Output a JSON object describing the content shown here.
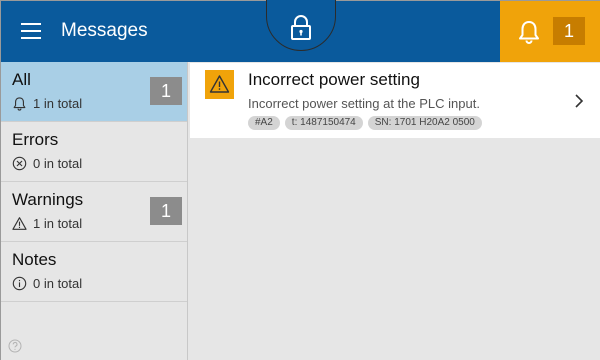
{
  "header": {
    "title": "Messages",
    "menu_icon": "hamburger-menu-icon",
    "lock_icon": "padlock-icon",
    "alarm": {
      "icon": "bell-icon",
      "count": "1",
      "color": "#f0a30a"
    },
    "color": "#0a5a9c"
  },
  "sidebar": {
    "items": [
      {
        "label": "All",
        "sub": "1 in total",
        "icon": "bell-icon",
        "badge": "1",
        "active": true
      },
      {
        "label": "Errors",
        "sub": "0 in total",
        "icon": "error-circle-x-icon",
        "badge": null,
        "active": false
      },
      {
        "label": "Warnings",
        "sub": "1 in total",
        "icon": "warning-triangle-icon",
        "badge": "1",
        "active": false
      },
      {
        "label": "Notes",
        "sub": "0 in total",
        "icon": "info-circle-icon",
        "badge": null,
        "active": false
      }
    ],
    "active_color": "#a9cfe6"
  },
  "messages": [
    {
      "icon": "warning-triangle-icon",
      "title": "Incorrect power setting",
      "description": "Incorrect power setting at the PLC input.",
      "tags": [
        "#A2",
        "t: 1487150474",
        "SN: 1701 H20A2 0500"
      ]
    }
  ]
}
